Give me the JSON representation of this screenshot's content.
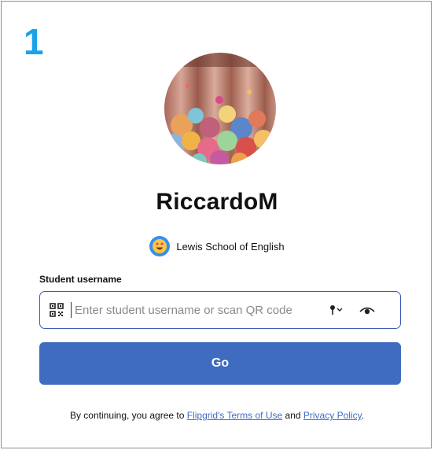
{
  "step": {
    "number": "1",
    "color": "#1aa3e8"
  },
  "profile": {
    "username": "RiccardoM",
    "avatar_icon": "balloons-photo-avatar"
  },
  "school": {
    "name": "Lewis School of English",
    "badge_icon": "smiley-face-icon"
  },
  "form": {
    "field_label": "Student username",
    "placeholder": "Enter student username or scan QR code",
    "value": "",
    "qr_icon": "qr-code-icon",
    "key_icon": "key-dropdown-icon",
    "eye_icon": "eye-icon",
    "go_label": "Go",
    "accent_color": "#3f6cc0"
  },
  "legal": {
    "prefix": "By continuing, you agree to",
    "terms_link": "Flipgrid's Terms of Use",
    "connector": "and",
    "privacy_link": "Privacy Policy",
    "suffix": "."
  }
}
